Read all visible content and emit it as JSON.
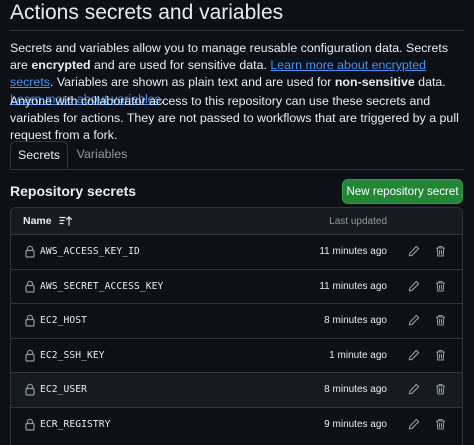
{
  "page": {
    "title": "Actions secrets and variables",
    "description": {
      "p1": "Secrets and variables allow you to manage reusable configuration data. Secrets are ",
      "encrypted": "encrypted",
      "p2": " and are used for sensitive data. ",
      "link1": "Learn more about encrypted secrets",
      "p3": ". Variables are shown as plain text and are used for ",
      "non_sensitive": "non-sensitive",
      "p4": " data. ",
      "link2": "Learn more about variables",
      "p5": "."
    },
    "access_note": "Anyone with collaborator access to this repository can use these secrets and variables for actions. They are not passed to workflows that are triggered by a pull request from a fork."
  },
  "tabs": [
    {
      "label": "Secrets",
      "active": true
    },
    {
      "label": "Variables",
      "active": false
    }
  ],
  "section": {
    "title": "Repository secrets",
    "new_button_label": "New repository secret"
  },
  "table": {
    "col_name": "Name",
    "col_updated": "Last updated",
    "rows": [
      {
        "name": "AWS_ACCESS_KEY_ID",
        "updated": "11 minutes ago"
      },
      {
        "name": "AWS_SECRET_ACCESS_KEY",
        "updated": "11 minutes ago"
      },
      {
        "name": "EC2_HOST",
        "updated": "8 minutes ago"
      },
      {
        "name": "EC2_SSH_KEY",
        "updated": "1 minute ago"
      },
      {
        "name": "EC2_USER",
        "updated": "8 minutes ago"
      },
      {
        "name": "ECR_REGISTRY",
        "updated": "9 minutes ago"
      }
    ]
  },
  "colors": {
    "background": "#0d1117",
    "link": "#4493f8",
    "primary_button": "#238636",
    "border": "#30363d"
  },
  "icons": [
    "sort-icon",
    "lock-icon",
    "pencil-icon",
    "trash-icon"
  ]
}
